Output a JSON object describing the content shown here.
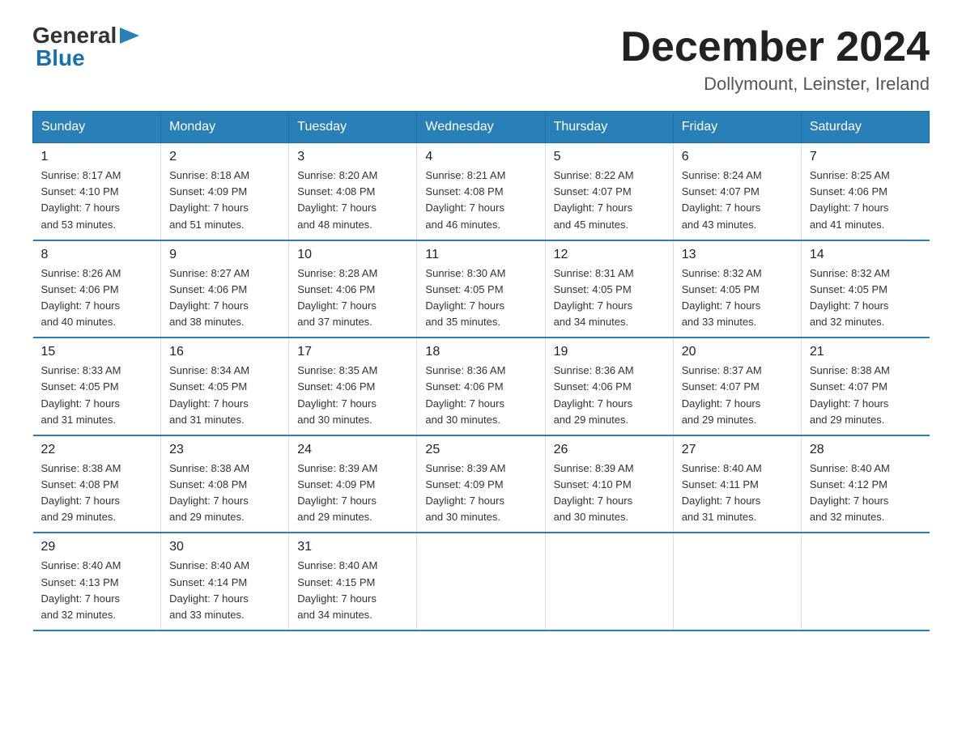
{
  "header": {
    "logo_general": "General",
    "logo_blue": "Blue",
    "month_title": "December 2024",
    "location": "Dollymount, Leinster, Ireland"
  },
  "weekdays": [
    "Sunday",
    "Monday",
    "Tuesday",
    "Wednesday",
    "Thursday",
    "Friday",
    "Saturday"
  ],
  "weeks": [
    [
      {
        "day": "1",
        "sunrise": "8:17 AM",
        "sunset": "4:10 PM",
        "daylight": "7 hours and 53 minutes."
      },
      {
        "day": "2",
        "sunrise": "8:18 AM",
        "sunset": "4:09 PM",
        "daylight": "7 hours and 51 minutes."
      },
      {
        "day": "3",
        "sunrise": "8:20 AM",
        "sunset": "4:08 PM",
        "daylight": "7 hours and 48 minutes."
      },
      {
        "day": "4",
        "sunrise": "8:21 AM",
        "sunset": "4:08 PM",
        "daylight": "7 hours and 46 minutes."
      },
      {
        "day": "5",
        "sunrise": "8:22 AM",
        "sunset": "4:07 PM",
        "daylight": "7 hours and 45 minutes."
      },
      {
        "day": "6",
        "sunrise": "8:24 AM",
        "sunset": "4:07 PM",
        "daylight": "7 hours and 43 minutes."
      },
      {
        "day": "7",
        "sunrise": "8:25 AM",
        "sunset": "4:06 PM",
        "daylight": "7 hours and 41 minutes."
      }
    ],
    [
      {
        "day": "8",
        "sunrise": "8:26 AM",
        "sunset": "4:06 PM",
        "daylight": "7 hours and 40 minutes."
      },
      {
        "day": "9",
        "sunrise": "8:27 AM",
        "sunset": "4:06 PM",
        "daylight": "7 hours and 38 minutes."
      },
      {
        "day": "10",
        "sunrise": "8:28 AM",
        "sunset": "4:06 PM",
        "daylight": "7 hours and 37 minutes."
      },
      {
        "day": "11",
        "sunrise": "8:30 AM",
        "sunset": "4:05 PM",
        "daylight": "7 hours and 35 minutes."
      },
      {
        "day": "12",
        "sunrise": "8:31 AM",
        "sunset": "4:05 PM",
        "daylight": "7 hours and 34 minutes."
      },
      {
        "day": "13",
        "sunrise": "8:32 AM",
        "sunset": "4:05 PM",
        "daylight": "7 hours and 33 minutes."
      },
      {
        "day": "14",
        "sunrise": "8:32 AM",
        "sunset": "4:05 PM",
        "daylight": "7 hours and 32 minutes."
      }
    ],
    [
      {
        "day": "15",
        "sunrise": "8:33 AM",
        "sunset": "4:05 PM",
        "daylight": "7 hours and 31 minutes."
      },
      {
        "day": "16",
        "sunrise": "8:34 AM",
        "sunset": "4:05 PM",
        "daylight": "7 hours and 31 minutes."
      },
      {
        "day": "17",
        "sunrise": "8:35 AM",
        "sunset": "4:06 PM",
        "daylight": "7 hours and 30 minutes."
      },
      {
        "day": "18",
        "sunrise": "8:36 AM",
        "sunset": "4:06 PM",
        "daylight": "7 hours and 30 minutes."
      },
      {
        "day": "19",
        "sunrise": "8:36 AM",
        "sunset": "4:06 PM",
        "daylight": "7 hours and 29 minutes."
      },
      {
        "day": "20",
        "sunrise": "8:37 AM",
        "sunset": "4:07 PM",
        "daylight": "7 hours and 29 minutes."
      },
      {
        "day": "21",
        "sunrise": "8:38 AM",
        "sunset": "4:07 PM",
        "daylight": "7 hours and 29 minutes."
      }
    ],
    [
      {
        "day": "22",
        "sunrise": "8:38 AM",
        "sunset": "4:08 PM",
        "daylight": "7 hours and 29 minutes."
      },
      {
        "day": "23",
        "sunrise": "8:38 AM",
        "sunset": "4:08 PM",
        "daylight": "7 hours and 29 minutes."
      },
      {
        "day": "24",
        "sunrise": "8:39 AM",
        "sunset": "4:09 PM",
        "daylight": "7 hours and 29 minutes."
      },
      {
        "day": "25",
        "sunrise": "8:39 AM",
        "sunset": "4:09 PM",
        "daylight": "7 hours and 30 minutes."
      },
      {
        "day": "26",
        "sunrise": "8:39 AM",
        "sunset": "4:10 PM",
        "daylight": "7 hours and 30 minutes."
      },
      {
        "day": "27",
        "sunrise": "8:40 AM",
        "sunset": "4:11 PM",
        "daylight": "7 hours and 31 minutes."
      },
      {
        "day": "28",
        "sunrise": "8:40 AM",
        "sunset": "4:12 PM",
        "daylight": "7 hours and 32 minutes."
      }
    ],
    [
      {
        "day": "29",
        "sunrise": "8:40 AM",
        "sunset": "4:13 PM",
        "daylight": "7 hours and 32 minutes."
      },
      {
        "day": "30",
        "sunrise": "8:40 AM",
        "sunset": "4:14 PM",
        "daylight": "7 hours and 33 minutes."
      },
      {
        "day": "31",
        "sunrise": "8:40 AM",
        "sunset": "4:15 PM",
        "daylight": "7 hours and 34 minutes."
      },
      null,
      null,
      null,
      null
    ]
  ],
  "labels": {
    "sunrise": "Sunrise:",
    "sunset": "Sunset:",
    "daylight": "Daylight:"
  }
}
